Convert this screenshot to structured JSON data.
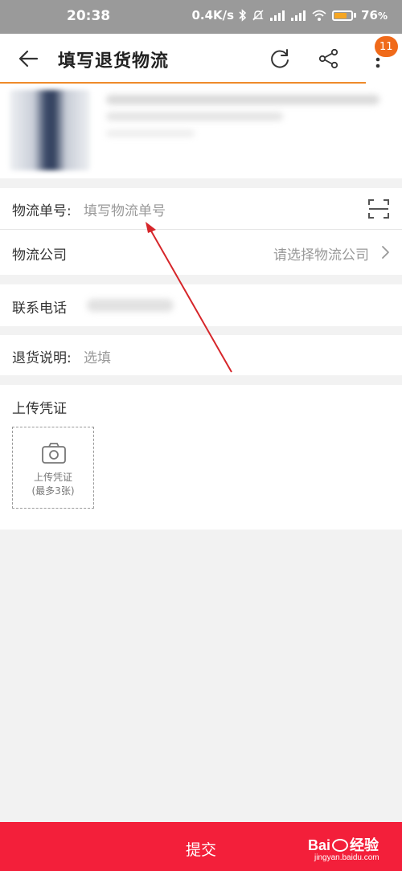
{
  "status_bar": {
    "time": "20:38",
    "speed": "0.4K/s",
    "battery": "76",
    "battery_unit": "%",
    "battery_level": 0.76
  },
  "header": {
    "title": "填写退货物流",
    "badge_count": "11"
  },
  "form": {
    "tracking_label": "物流单号:",
    "tracking_placeholder": "填写物流单号",
    "company_label": "物流公司",
    "company_placeholder": "请选择物流公司",
    "phone_label": "联系电话",
    "note_label": "退货说明:",
    "note_placeholder": "选填"
  },
  "upload": {
    "section_title": "上传凭证",
    "box_label": "上传凭证",
    "box_sub": "(最多3张)"
  },
  "submit": {
    "label": "提交"
  },
  "watermark": {
    "main": "Bai",
    "brand_suffix": "经验",
    "site": "jingyan.baidu.com"
  },
  "colors": {
    "accent_orange": "#ee8a2a",
    "badge_orange": "#f06a1a",
    "submit_red": "#f31f3a",
    "annotation_arrow": "#d6262a"
  },
  "icons": [
    "back-arrow-icon",
    "refresh-icon",
    "share-icon",
    "more-vertical-icon",
    "scan-icon",
    "chevron-right-icon",
    "camera-icon"
  ]
}
